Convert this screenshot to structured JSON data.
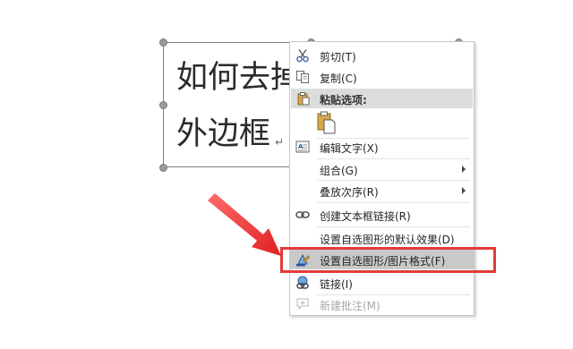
{
  "textbox": {
    "line1": "如何去掉",
    "line2": "外边框",
    "para_mark": "↵"
  },
  "menu": {
    "items": [
      {
        "label": "剪切(T)",
        "icon": "scissors-icon"
      },
      {
        "label": "复制(C)",
        "icon": "copy-icon"
      },
      {
        "label": "粘贴选项:",
        "icon": "paste-icon"
      },
      {
        "label": "编辑文字(X)",
        "icon": "edit-text-icon"
      },
      {
        "label": "组合(G)",
        "icon": ""
      },
      {
        "label": "叠放次序(R)",
        "icon": ""
      },
      {
        "label": "创建文本框链接(R)",
        "icon": "link-chain-icon"
      },
      {
        "label": "设置自选图形的默认效果(D)",
        "icon": ""
      },
      {
        "label": "设置自选图形/图片格式(F)",
        "icon": "format-shape-icon"
      },
      {
        "label": "链接(I)",
        "icon": "hyperlink-icon"
      },
      {
        "label": "新建批注(M)",
        "icon": "comment-icon"
      }
    ]
  },
  "colors": {
    "highlight_frame": "#e43a3a",
    "hover_row": "#c9c9c9",
    "header_row": "#dcdcdc"
  }
}
